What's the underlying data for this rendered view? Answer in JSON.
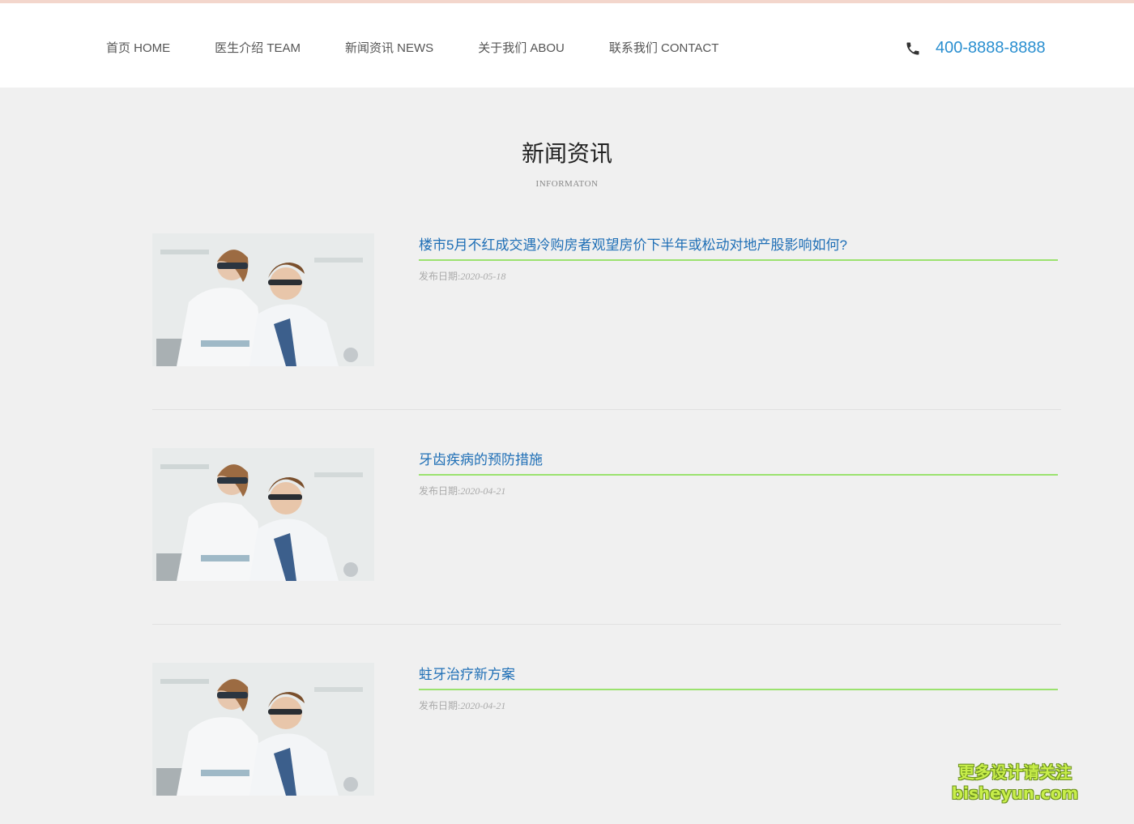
{
  "nav": {
    "items": [
      {
        "label": "首页 HOME"
      },
      {
        "label": "医生介绍 TEAM"
      },
      {
        "label": "新闻资讯 NEWS"
      },
      {
        "label": "关于我们 ABOU"
      },
      {
        "label": "联系我们 CONTACT"
      }
    ],
    "phone": "400-8888-8888"
  },
  "section": {
    "title": "新闻资讯",
    "subtitle": "INFORMATON"
  },
  "news": [
    {
      "title": "楼市5月不红成交遇冷购房者观望房价下半年或松动对地产股影响如何?",
      "date_label": "发布日期:",
      "date": "2020-05-18"
    },
    {
      "title": "牙齿疾病的预防措施",
      "date_label": "发布日期:",
      "date": "2020-04-21"
    },
    {
      "title": "蛀牙治疗新方案",
      "date_label": "发布日期:",
      "date": "2020-04-21"
    }
  ],
  "watermark": {
    "line1": "更多设计请关注",
    "line2": "bisheyun.com"
  },
  "colors": {
    "accent": "#2a8fd0",
    "link": "#1f6fb6",
    "underline": "#9be26f",
    "background": "#f0f0f0"
  }
}
